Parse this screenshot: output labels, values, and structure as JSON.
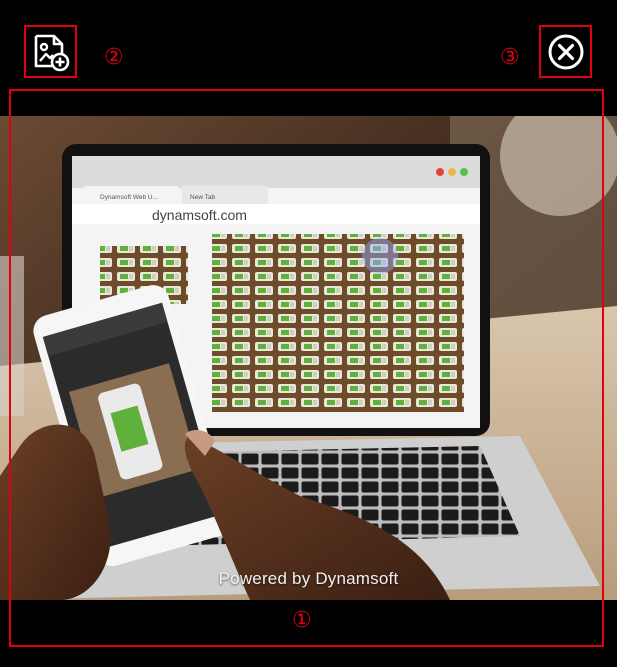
{
  "toolbar": {
    "add_image_icon": "image-add-icon",
    "close_icon": "close-circle-icon"
  },
  "callouts": {
    "one": "①",
    "two": "②",
    "three": "③"
  },
  "video": {
    "browser_tab_1": "Dynamsoft Web U...",
    "browser_tab_2": "New Tab",
    "browser_url": "dynamsoft.com",
    "watermark": "Powered by Dynamsoft"
  },
  "colors": {
    "annotation": "#e0000f",
    "background": "#000000"
  }
}
